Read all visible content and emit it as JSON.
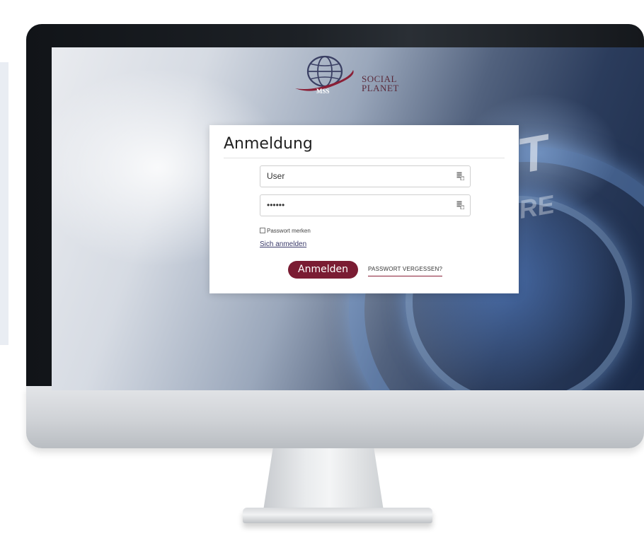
{
  "logo": {
    "badge": "MSS",
    "brand_line1": "SOCIAL",
    "brand_line2": "PLANET"
  },
  "background_text": {
    "word1": "RT",
    "word2": "RE"
  },
  "login": {
    "title": "Anmeldung",
    "username_value": "User",
    "password_value": "••••••",
    "remember_label": "Passwort merken",
    "remember_checked": false,
    "signin_link": "Sich anmelden",
    "submit_label": "Anmelden",
    "forgot_label": "PASSWORT VERGESSEN?"
  },
  "colors": {
    "accent": "#7a1c33",
    "logo_text": "#5a2a3a"
  },
  "icons": {
    "username_field": "credential-icon",
    "password_field": "credential-icon"
  }
}
